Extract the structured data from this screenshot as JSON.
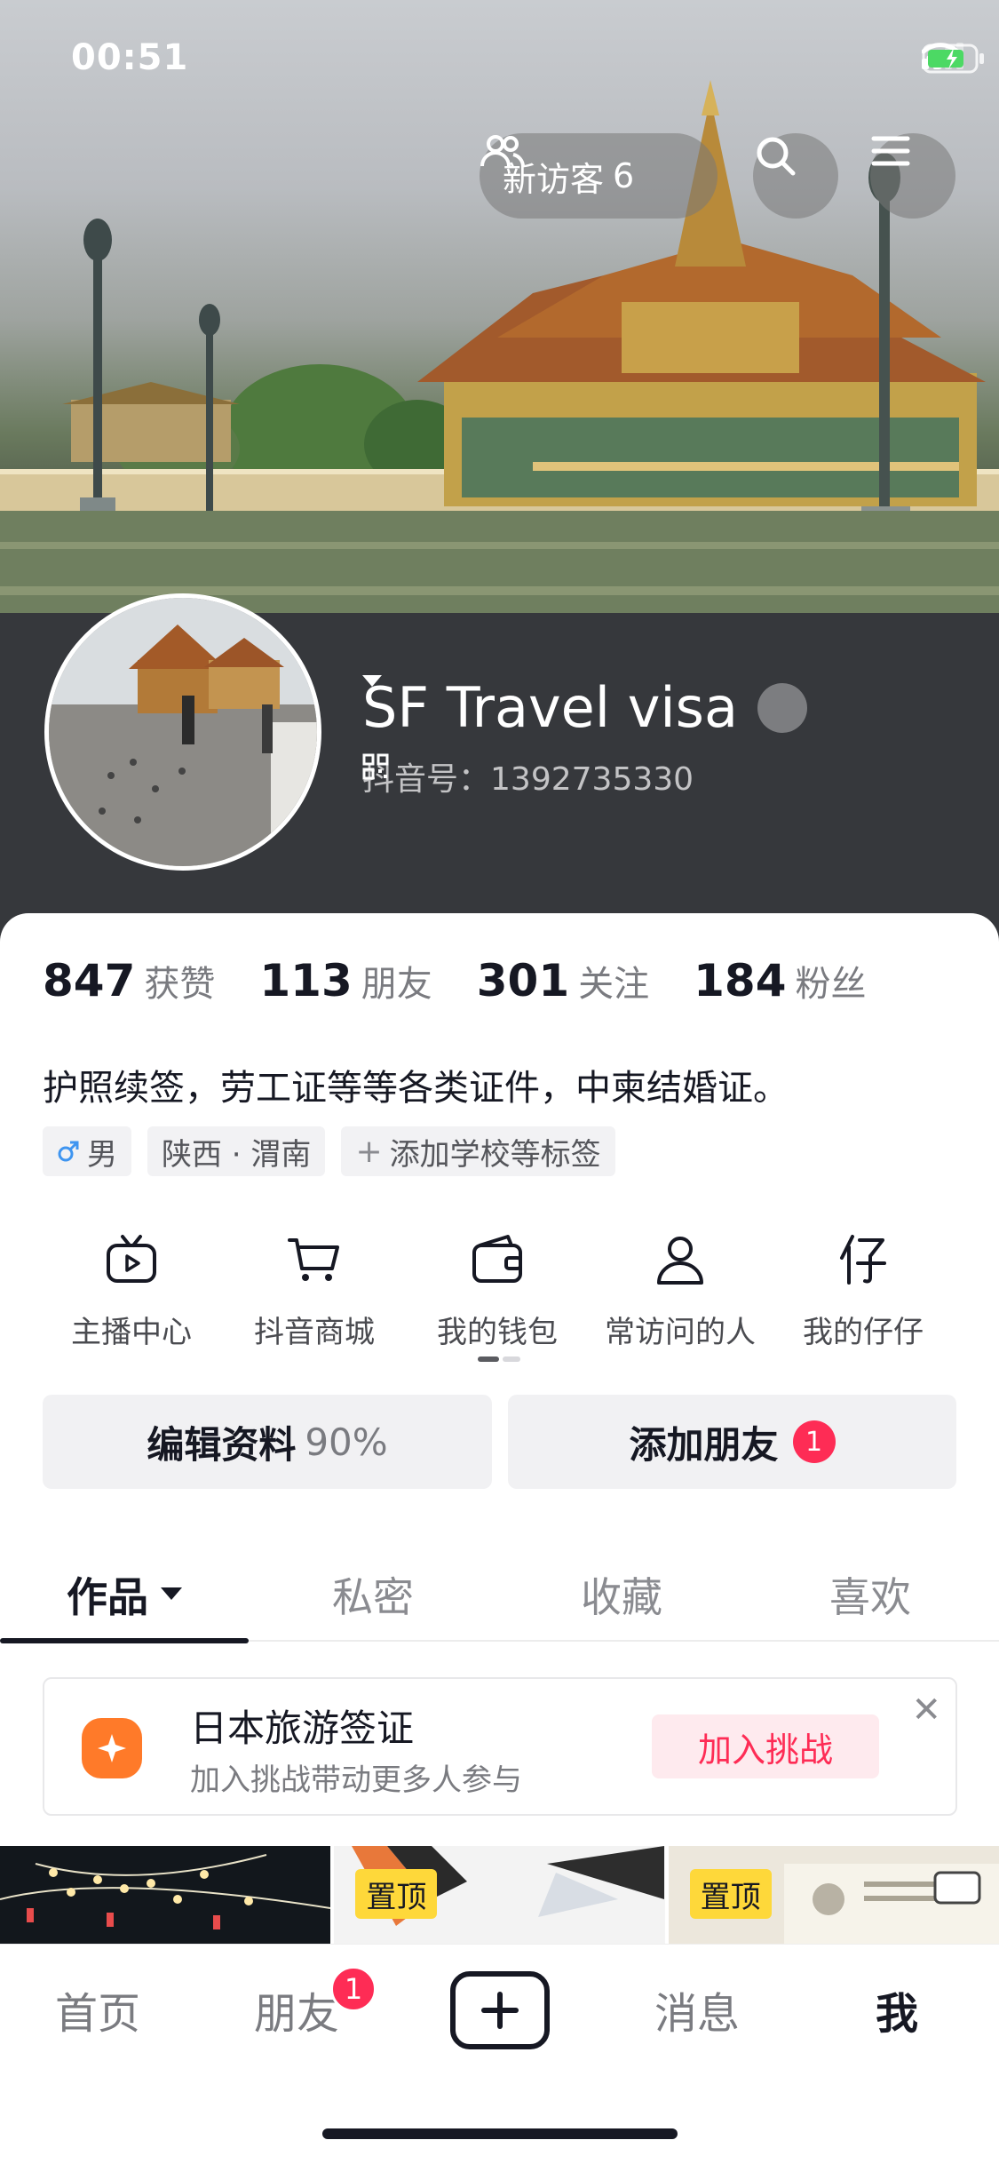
{
  "status_bar": {
    "time": "00:51"
  },
  "header": {
    "visitor_label": "新访客",
    "visitor_count": "6",
    "icons": [
      "visitors-icon",
      "search-icon",
      "menu-icon"
    ]
  },
  "profile": {
    "name": "SF Travel visa",
    "douyin_id_label": "抖音号：",
    "douyin_id": "1392735330"
  },
  "stats": [
    {
      "num": "847",
      "label": "获赞"
    },
    {
      "num": "113",
      "label": "朋友"
    },
    {
      "num": "301",
      "label": "关注"
    },
    {
      "num": "184",
      "label": "粉丝"
    }
  ],
  "bio": "护照续签，劳工证等等各类证件，中柬结婚证。",
  "tags": {
    "gender": "男",
    "location": "陕西 · 渭南",
    "add": "添加学校等标签"
  },
  "quick_actions": [
    {
      "label": "主播中心",
      "icon": "tv-icon"
    },
    {
      "label": "抖音商城",
      "icon": "cart-icon"
    },
    {
      "label": "我的钱包",
      "icon": "wallet-icon"
    },
    {
      "label": "常访问的人",
      "icon": "person-icon"
    },
    {
      "label": "我的仔仔",
      "icon": "zaizai-icon"
    }
  ],
  "buttons": {
    "edit_label": "编辑资料",
    "edit_percent": "90%",
    "add_friend_label": "添加朋友",
    "add_friend_badge": "1"
  },
  "tabs": [
    {
      "label": "作品",
      "active": true
    },
    {
      "label": "私密",
      "active": false
    },
    {
      "label": "收藏",
      "active": false
    },
    {
      "label": "喜欢",
      "active": false
    }
  ],
  "challenge": {
    "title": "日本旅游签证",
    "subtitle": "加入挑战带动更多人参与",
    "button": "加入挑战"
  },
  "grid": {
    "pin_label": "置顶"
  },
  "bottom_nav": {
    "home": "首页",
    "friends": "朋友",
    "friends_badge": "1",
    "messages": "消息",
    "me": "我"
  },
  "colors": {
    "accent": "#fe2c55",
    "pin": "#fed83a",
    "challenge_icon": "#ff7a29"
  }
}
